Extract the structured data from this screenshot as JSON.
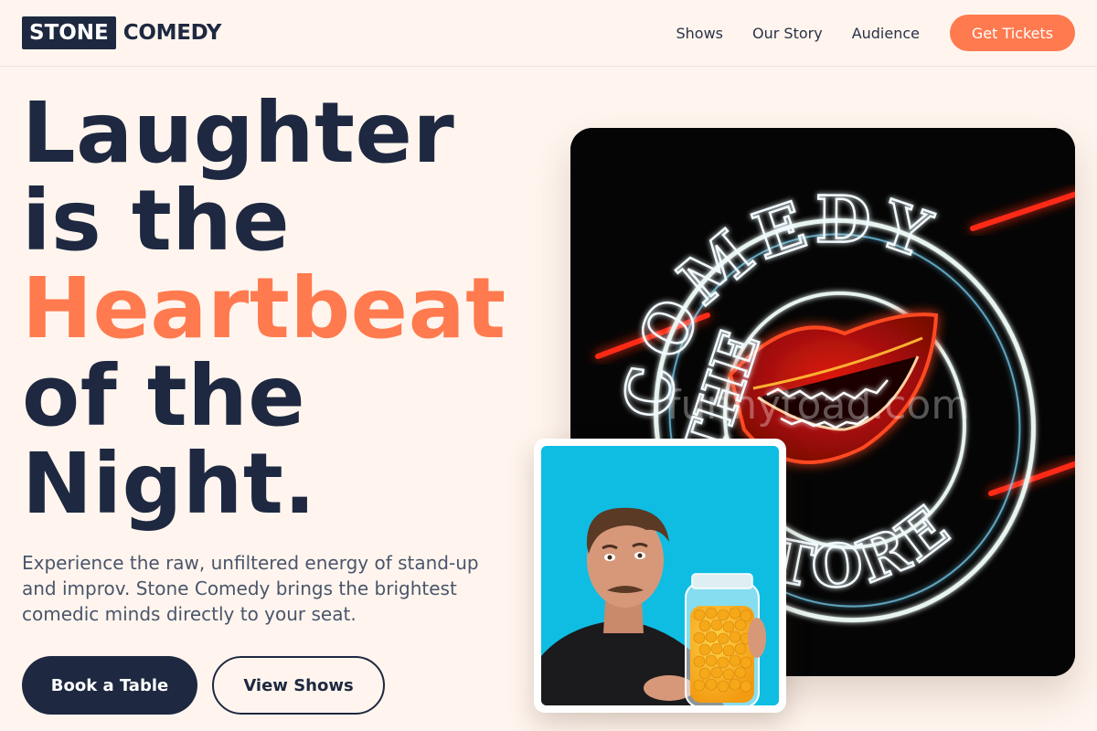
{
  "brand": {
    "box": "STONE",
    "text": "COMEDY"
  },
  "nav": {
    "links": [
      "Shows",
      "Our Story",
      "Audience"
    ],
    "cta": "Get Tickets"
  },
  "hero": {
    "line1": "Laughter",
    "line2": "is the",
    "line3": "Heartbeat",
    "line4": "of the",
    "line5": "Night.",
    "subtext": "Experience the raw, unfiltered energy of stand-up and improv. Stone Comedy brings the brightest comedic minds directly to your seat.",
    "primary_button": "Book a Table",
    "secondary_button": "View Shows"
  },
  "images": {
    "neon_sign_text_top": "COMEDY",
    "neon_sign_text_left": "THE",
    "neon_sign_text_bottom": "STORE",
    "watermark": "funnytoad.com"
  },
  "colors": {
    "accent": "#ff7a4f",
    "navy": "#1e2840",
    "background": "#fff5ee"
  }
}
